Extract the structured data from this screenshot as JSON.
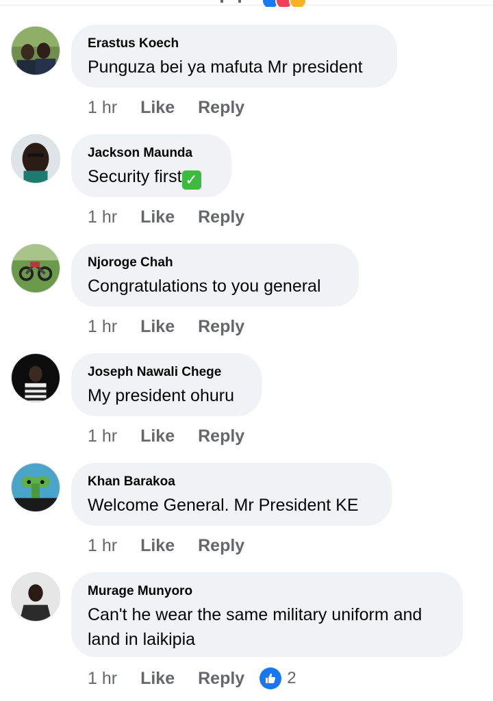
{
  "accent": "#1877f2",
  "bubble_color": "#f0f2f5",
  "comments": [
    {
      "author": "Erastus Koech",
      "text": "Punguza bei ya mafuta Mr president",
      "time": "1 hr",
      "like_label": "Like",
      "reply_label": "Reply"
    },
    {
      "author": "Jackson Maunda",
      "text": "Security first",
      "emoji": "check-mark-icon",
      "time": "1 hr",
      "like_label": "Like",
      "reply_label": "Reply"
    },
    {
      "author": "Njoroge Chah",
      "text": "Congratulations to you general",
      "time": "1 hr",
      "like_label": "Like",
      "reply_label": "Reply"
    },
    {
      "author": "Joseph Nawali Chege",
      "text": "My president ohuru",
      "time": "1 hr",
      "like_label": "Like",
      "reply_label": "Reply"
    },
    {
      "author": "Khan Barakoa",
      "text": "Welcome General. Mr President KE",
      "time": "1 hr",
      "like_label": "Like",
      "reply_label": "Reply"
    },
    {
      "author": "Murage Munyoro",
      "text": "Can't he wear the same military uniform and land in laikipia",
      "time": "1 hr",
      "like_label": "Like",
      "reply_label": "Reply",
      "reaction_icon": "thumbs-up-icon",
      "reaction_count": "2"
    }
  ]
}
